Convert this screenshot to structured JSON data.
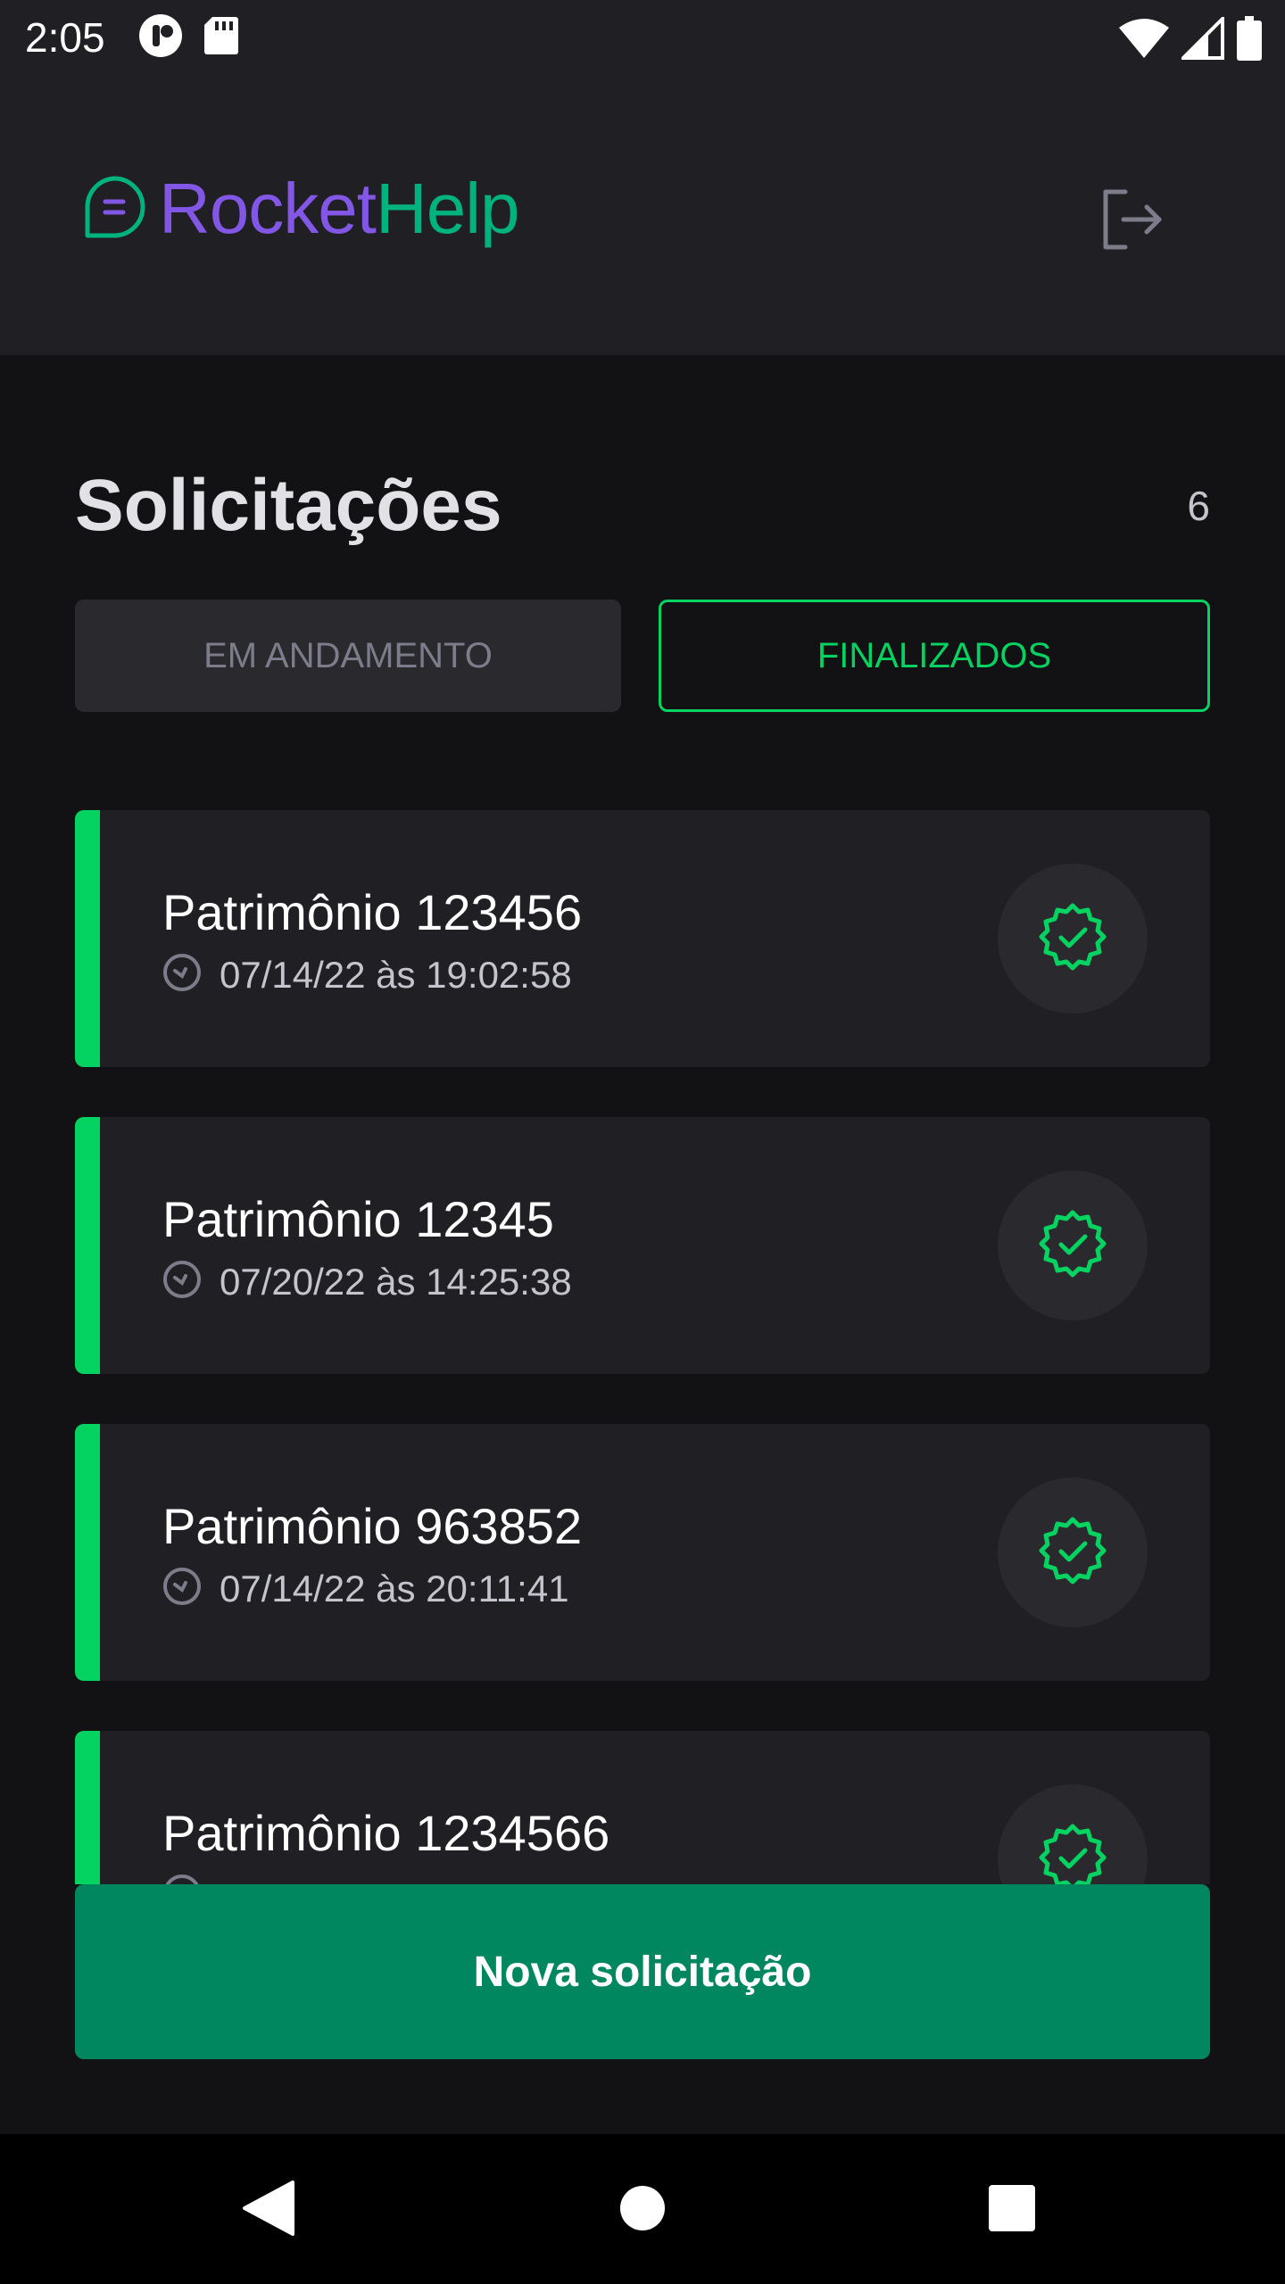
{
  "status_bar": {
    "time": "2:05",
    "left_icons": [
      "notification-icon",
      "sd-card-icon"
    ],
    "right_icons": [
      "wifi-icon",
      "signal-icon",
      "battery-icon"
    ]
  },
  "header": {
    "logo_part1": "Rocket",
    "logo_part2": "Help",
    "logo_icon": "chat-bubble-icon",
    "logout_icon": "sign-out-icon"
  },
  "main": {
    "title": "Solicitações",
    "count": "6"
  },
  "filters": {
    "open_label": "EM ANDAMENTO",
    "closed_label": "FINALIZADOS",
    "selected": "FINALIZADOS"
  },
  "orders": [
    {
      "title": "Patrimônio 123456",
      "date": "07/14/22 às 19:02:58",
      "status": "closed"
    },
    {
      "title": "Patrimônio 12345",
      "date": "07/20/22 às 14:25:38",
      "status": "closed"
    },
    {
      "title": "Patrimônio 963852",
      "date": "07/14/22 às 20:11:41",
      "status": "closed"
    },
    {
      "title": "Patrimônio 1234566",
      "date": "",
      "status": "closed"
    }
  ],
  "actions": {
    "new_request": "Nova solicitação"
  },
  "colors": {
    "background": "#121214",
    "surface": "#202024",
    "brand_purple": "#8257e5",
    "brand_green": "#00b37e",
    "closed_green": "#04d361",
    "button_green": "#00875f"
  }
}
